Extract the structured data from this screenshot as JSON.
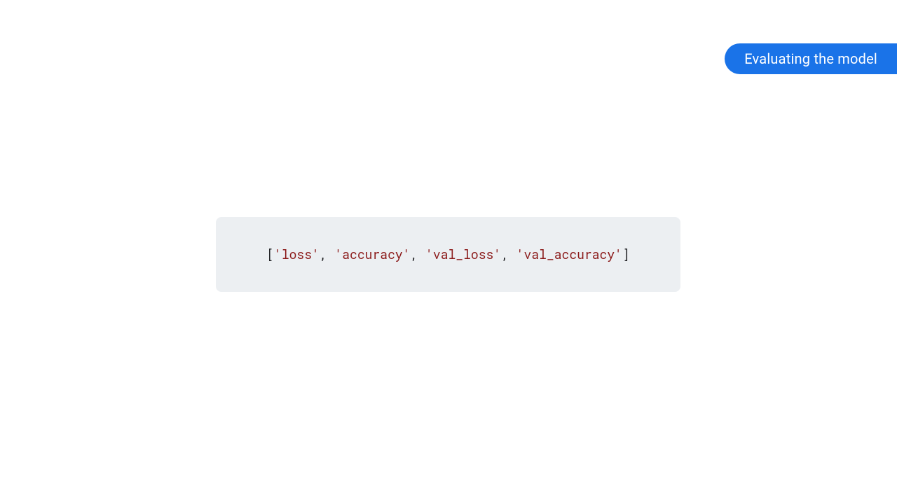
{
  "header": {
    "badge_text": "Evaluating the model"
  },
  "code": {
    "open_bracket": "[",
    "item1": "'loss'",
    "sep1": ", ",
    "item2": "'accuracy'",
    "sep2": ", ",
    "item3": "'val_loss'",
    "sep3": ", ",
    "item4": "'val_accuracy'",
    "close_bracket": "]"
  }
}
